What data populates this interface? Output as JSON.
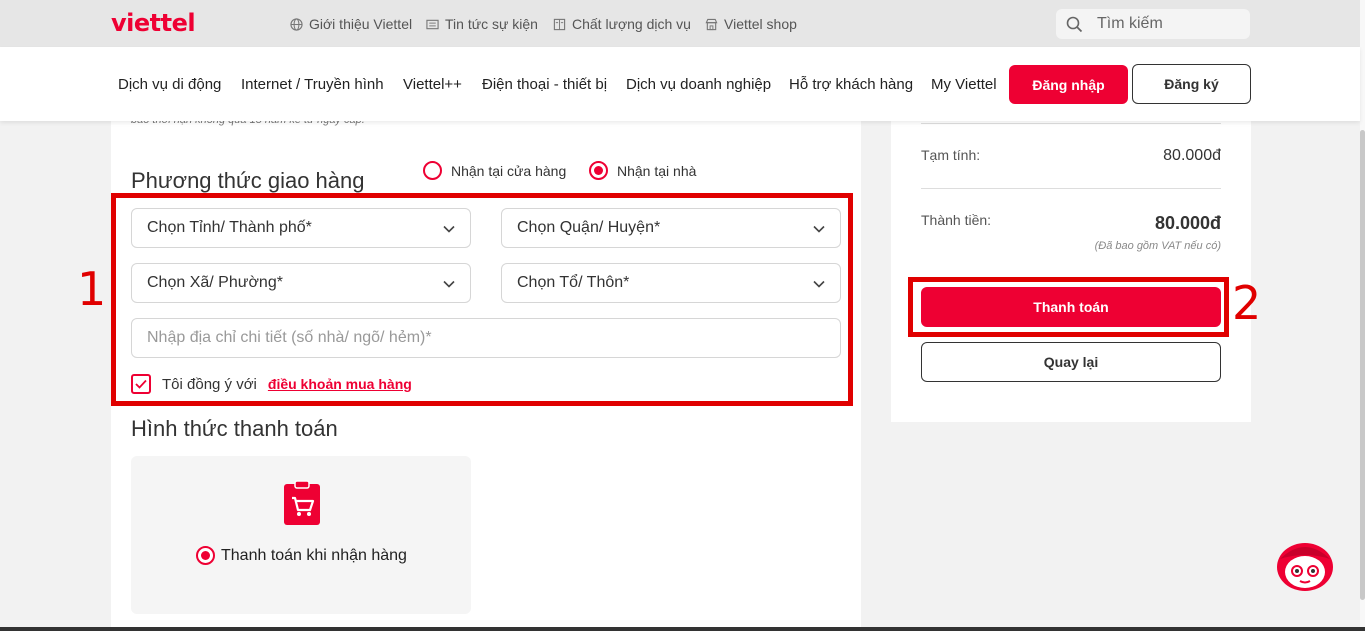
{
  "header": {
    "logo": "viettel",
    "top_links": [
      {
        "label": "Giới thiệu Viettel",
        "icon": "globe-icon"
      },
      {
        "label": "Tin tức sự kiện",
        "icon": "newspaper-icon"
      },
      {
        "label": "Chất lượng dịch vụ",
        "icon": "book-icon"
      },
      {
        "label": "Viettel shop",
        "icon": "store-icon"
      }
    ],
    "search_placeholder": "Tìm kiếm",
    "nav": [
      "Dịch vụ di động",
      "Internet / Truyền hình",
      "Viettel++",
      "Điện thoại - thiết bị",
      "Dịch vụ doanh nghiệp",
      "Hỗ trợ khách hàng",
      "My Viettel"
    ],
    "login_label": "Đăng nhập",
    "register_label": "Đăng ký"
  },
  "form": {
    "note": "bảo thời hạn không quá 15 năm kể từ ngày cấp.",
    "delivery_title": "Phương thức giao hàng",
    "delivery_options": [
      {
        "label": "Nhận tại cửa hàng",
        "selected": false
      },
      {
        "label": "Nhận tại nhà",
        "selected": true
      }
    ],
    "province_label": "Chọn Tỉnh/ Thành phố*",
    "district_label": "Chọn Quận/ Huyện*",
    "ward_label": "Chọn Xã/ Phường*",
    "hamlet_label": "Chọn Tổ/ Thôn*",
    "address_placeholder": "Nhập địa chỉ chi tiết (số nhà/ ngõ/ hẻm)*",
    "agree_text": "Tôi đồng ý với",
    "terms_link": "điều khoản mua hàng",
    "payment_title": "Hình thức thanh toán",
    "payment_option": "Thanh toán khi nhận hàng"
  },
  "summary": {
    "subtotal_label": "Tạm tính:",
    "subtotal_value": "80.000đ",
    "total_label": "Thành tiền:",
    "total_value": "80.000đ",
    "vat_note": "(Đã bao gồm VAT nếu có)",
    "pay_button": "Thanh toán",
    "back_button": "Quay lại"
  },
  "annotations": {
    "box1_number": "1",
    "box2_number": "2"
  },
  "colors": {
    "brand": "#ee0033",
    "annotation": "#e00000"
  }
}
